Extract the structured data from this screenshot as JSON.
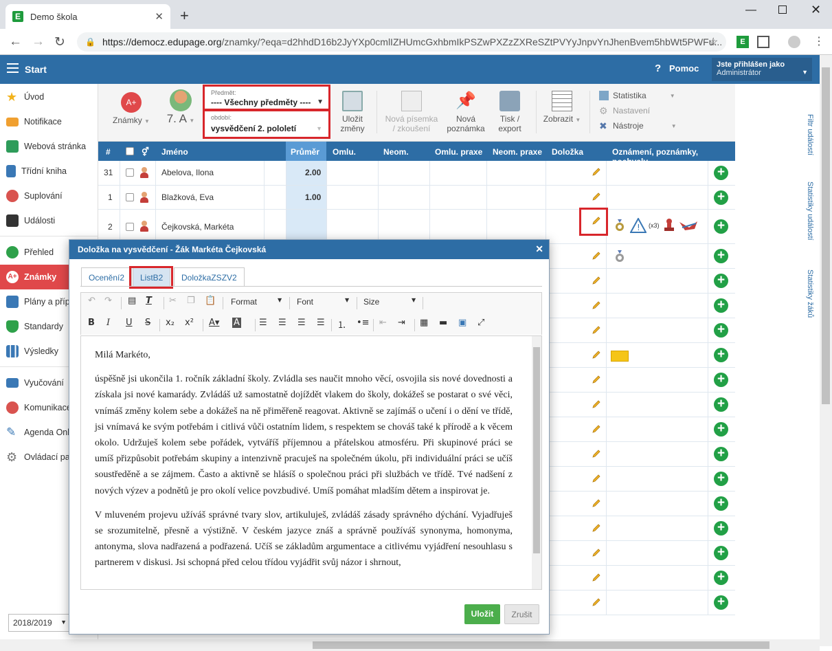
{
  "browser": {
    "tab_title": "Demo škola",
    "url_domain": "https://democz.edupage.org",
    "url_path": "/znamky/?eqa=d2hhdD16b2JyYXp0cmlIZHUmcGxhbmIkPSZwPXZzZXReSZtPVYyJnpvYnJhenBvem5hbWt5PWFu..."
  },
  "app": {
    "start": "Start",
    "help": "Pomoc",
    "user_line1": "Jste přihlášen jako",
    "user_line2": "Administrátor"
  },
  "sidebar": {
    "items": [
      {
        "label": "Úvod"
      },
      {
        "label": "Notifikace"
      },
      {
        "label": "Webová stránka"
      },
      {
        "label": "Třídní kniha"
      },
      {
        "label": "Suplování"
      },
      {
        "label": "Události"
      },
      {
        "label": "Přehled"
      },
      {
        "label": "Známky"
      },
      {
        "label": "Plány a příp"
      },
      {
        "label": "Standardy"
      },
      {
        "label": "Výsledky"
      },
      {
        "label": "Vyučování"
      },
      {
        "label": "Komunikace"
      },
      {
        "label": "Agenda Onl"
      },
      {
        "label": "Ovládací pa"
      }
    ],
    "year": "2018/2019"
  },
  "toolbar": {
    "znamky": "Známky",
    "class": "7. A",
    "subject_label": "Předmět:",
    "subject_value": "---- Všechny předměty ----",
    "period_label": "období:",
    "period_value": "vysvědčení 2. pololetí",
    "save_line1": "Uložit",
    "save_line2": "změny",
    "newtest_line1": "Nová písemka",
    "newtest_line2": "/ zkoušení",
    "newnote_line1": "Nová",
    "newnote_line2": "poznámka",
    "print_line1": "Tisk /",
    "print_line2": "export",
    "zobrazit": "Zobrazit",
    "statistika": "Statistika",
    "nastaveni": "Nastavení",
    "nastroje": "Nástroje"
  },
  "grid": {
    "headers": {
      "num": "#",
      "name": "Jméno",
      "avg": "Průměr",
      "omlu": "Omlu.",
      "neom": "Neom.",
      "omlu_praxe": "Omlu. praxe",
      "neom_praxe": "Neom. praxe",
      "dolozka": "Doložka",
      "notes": "Oznámení, poznámky, pochvaly"
    },
    "rows": [
      {
        "num": "31",
        "name": "Abelova, Ilona",
        "avg": "2.00"
      },
      {
        "num": "1",
        "name": "Blažková, Eva",
        "avg": "1.00"
      },
      {
        "num": "2",
        "name": "Čejkovská, Markéta",
        "avg": ""
      }
    ],
    "badge_count": "(x3)"
  },
  "rail": {
    "filter": "Filtr událostí",
    "stats_events": "Statistiky událostí",
    "stats_students": "Statistiky žáků"
  },
  "dialog": {
    "title": "Doložka na vysvědčení - Žák Markéta Čejkovská",
    "tabs": [
      "Ocenění2",
      "ListB2",
      "DoložkaZSZV2"
    ],
    "format": "Format",
    "font": "Font",
    "size": "Size",
    "para1": "Milá Markéto,",
    "para2": "úspěšně jsi ukončila 1. ročník základní školy. Zvládla ses naučit mnoho věcí, osvojila sis nové dovednosti a získala jsi nové kamarády. Zvládáš už samostatně dojíždět vlakem do školy, dokážeš se postarat o své věci, vnímáš změny kolem sebe a dokážeš na ně přiměřeně reagovat. Aktivně se zajímáš o učení i o dění ve třídě, jsi vnímavá ke svým potřebám i citlivá vůči ostatním lidem, s respektem se chováš také k přírodě a k věcem okolo. Udržuješ kolem sebe pořádek, vytváříš příjemnou a přátelskou atmosféru. Při skupinové práci se umíš přizpůsobit potřebám skupiny a intenzivně pracuješ na společném úkolu, při individuální práci se učíš soustředěně a se zájmem. Často a aktivně se hlásíš o společnou práci při službách ve třídě. Tvé nadšení z nových výzev a podnětů je pro okolí velice povzbudivé. Umíš pomáhat mladším dětem a inspirovat je.",
    "para3": "V mluveném projevu užíváš správné tvary slov, artikuluješ, zvládáš zásady správného dýchání. Vyjadřuješ se srozumitelně, přesně a výstižně. V českém jazyce znáš a správně používáš synonyma, homonyma, antonyma, slova nadřazená a podřazená. Učíš se základům argumentace a citlivému vyjádření nesouhlasu s partnerem v diskusi. Jsi schopná před celou třídou vyjádřit svůj názor i shrnout,",
    "save": "Uložit",
    "cancel": "Zrušit"
  }
}
